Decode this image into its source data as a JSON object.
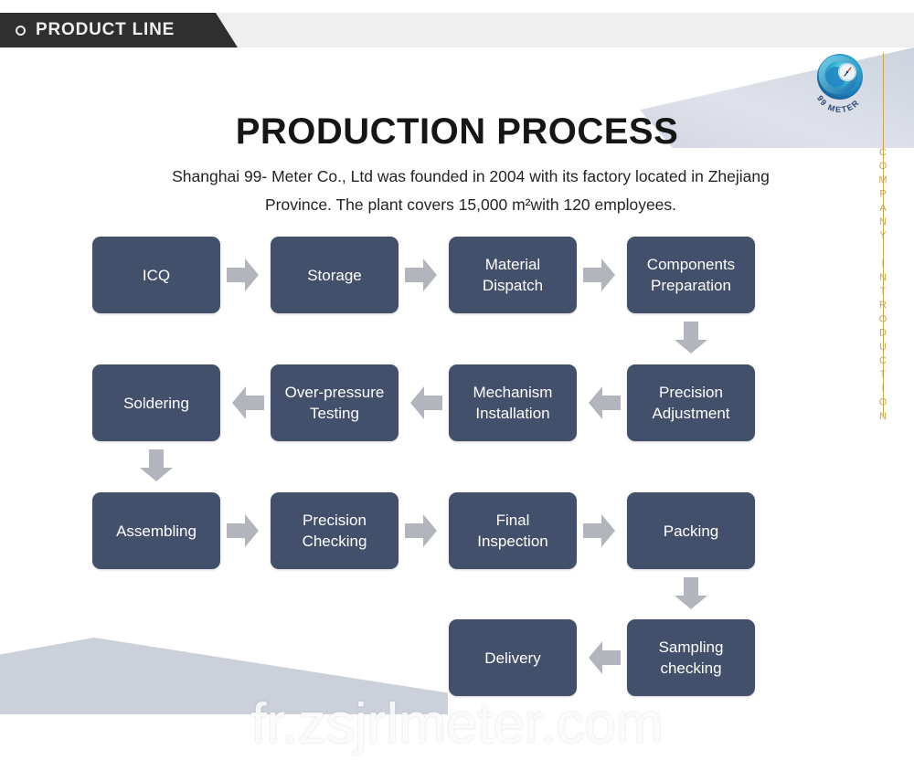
{
  "header": {
    "tab_label": "PRODUCT LINE",
    "tab_icon": "ring-icon",
    "tab_bg": "#2f2f2f",
    "band_bg": "#efefef"
  },
  "branding": {
    "logo_name": "99-meter-logo",
    "logo_text": "99 METER",
    "side_text": "COMPANY INTRODUCTION",
    "gold_color": "#c8a84b"
  },
  "page": {
    "title": "PRODUCTION PROCESS",
    "intro": "Shanghai 99- Meter Co., Ltd was founded in 2004 with its factory located in Zhejiang Province. The plant covers 15,000 m²with 120 employees."
  },
  "flow": {
    "node_color": "#43506b",
    "arrow_color": "#b2b5bb",
    "rows": [
      {
        "direction": "right",
        "nodes": [
          {
            "label": "ICQ"
          },
          {
            "label": "Storage"
          },
          {
            "label": "Material Dispatch"
          },
          {
            "label": "Components Preparation"
          }
        ]
      },
      {
        "direction": "left",
        "nodes": [
          {
            "label": "Soldering"
          },
          {
            "label": "Over-pressure Testing"
          },
          {
            "label": "Mechanism Installation"
          },
          {
            "label": "Precision Adjustment"
          }
        ]
      },
      {
        "direction": "right",
        "nodes": [
          {
            "label": "Assembling"
          },
          {
            "label": "Precision Checking"
          },
          {
            "label": "Final Inspection"
          },
          {
            "label": "Packing"
          }
        ]
      },
      {
        "direction": "left",
        "nodes": [
          {
            "label": "Delivery"
          },
          {
            "label": "Sampling checking"
          }
        ]
      }
    ],
    "labels": {
      "n0": "ICQ",
      "n1": "Storage",
      "n2_line1": "Material",
      "n2_line2": "Dispatch",
      "n3_line1": "Components",
      "n3_line2": "Preparation",
      "n4": "Soldering",
      "n5_line1": "Over-pressure",
      "n5_line2": "Testing",
      "n6_line1": "Mechanism",
      "n6_line2": "Installation",
      "n7_line1": "Precision",
      "n7_line2": "Adjustment",
      "n8": "Assembling",
      "n9_line1": "Precision",
      "n9_line2": "Checking",
      "n10_line1": "Final",
      "n10_line2": "Inspection",
      "n11": "Packing",
      "n12": "Delivery",
      "n13_line1": "Sampling",
      "n13_line2": "checking"
    }
  },
  "watermark": {
    "text": "fr.zsjrlmeter.com"
  }
}
